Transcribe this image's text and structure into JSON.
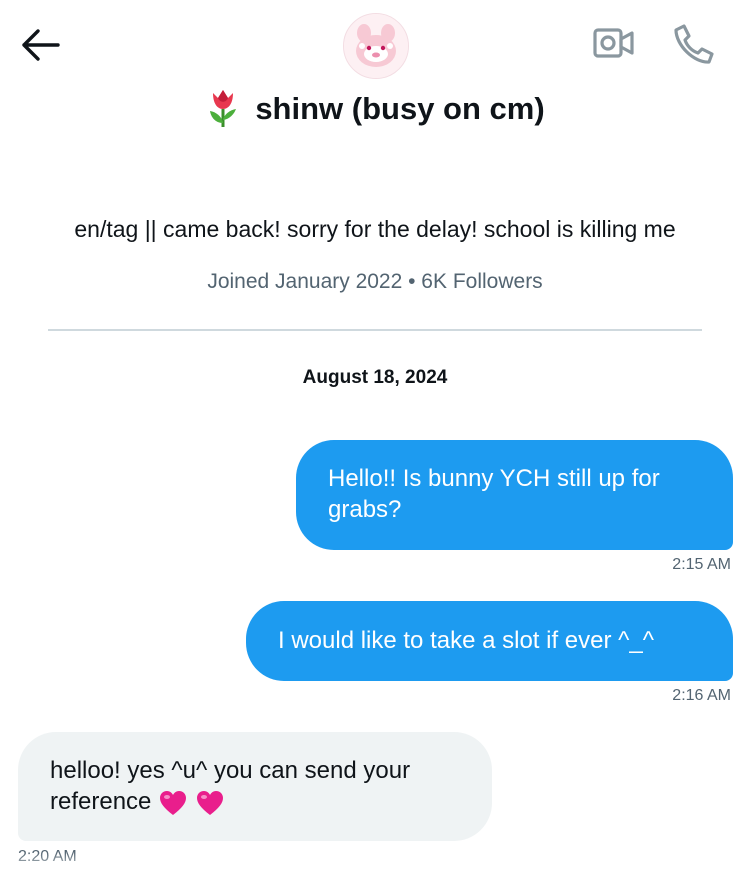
{
  "header": {
    "back_icon": "arrow-left-icon",
    "avatar_icon": "pink-bunny-avatar",
    "video_icon": "video-camera-icon",
    "call_icon": "phone-icon",
    "name_emoji": "tulip-emoji",
    "display_name": "shinw (busy on cm)"
  },
  "profile": {
    "bio": "en/tag || came back! sorry for the delay! school is killing me",
    "meta": "Joined January 2022 • 6K Followers"
  },
  "conversation": {
    "date": "August 18, 2024",
    "messages": [
      {
        "direction": "outgoing",
        "text": "Hello!! Is bunny YCH still up for grabs?",
        "time": "2:15 AM"
      },
      {
        "direction": "outgoing",
        "text": "I would like to take a slot if ever ^_^",
        "time": "2:16 AM"
      },
      {
        "direction": "incoming",
        "text": "helloo! yes ^u^ you can send your reference",
        "emojis": [
          "pink-heart-emoji",
          "pink-heart-emoji"
        ],
        "time": "2:20 AM"
      }
    ]
  },
  "colors": {
    "outgoing_bubble": "#1d9bf0",
    "incoming_bubble": "#eff3f4",
    "secondary_text": "#536471",
    "divider": "#cfd9de"
  }
}
